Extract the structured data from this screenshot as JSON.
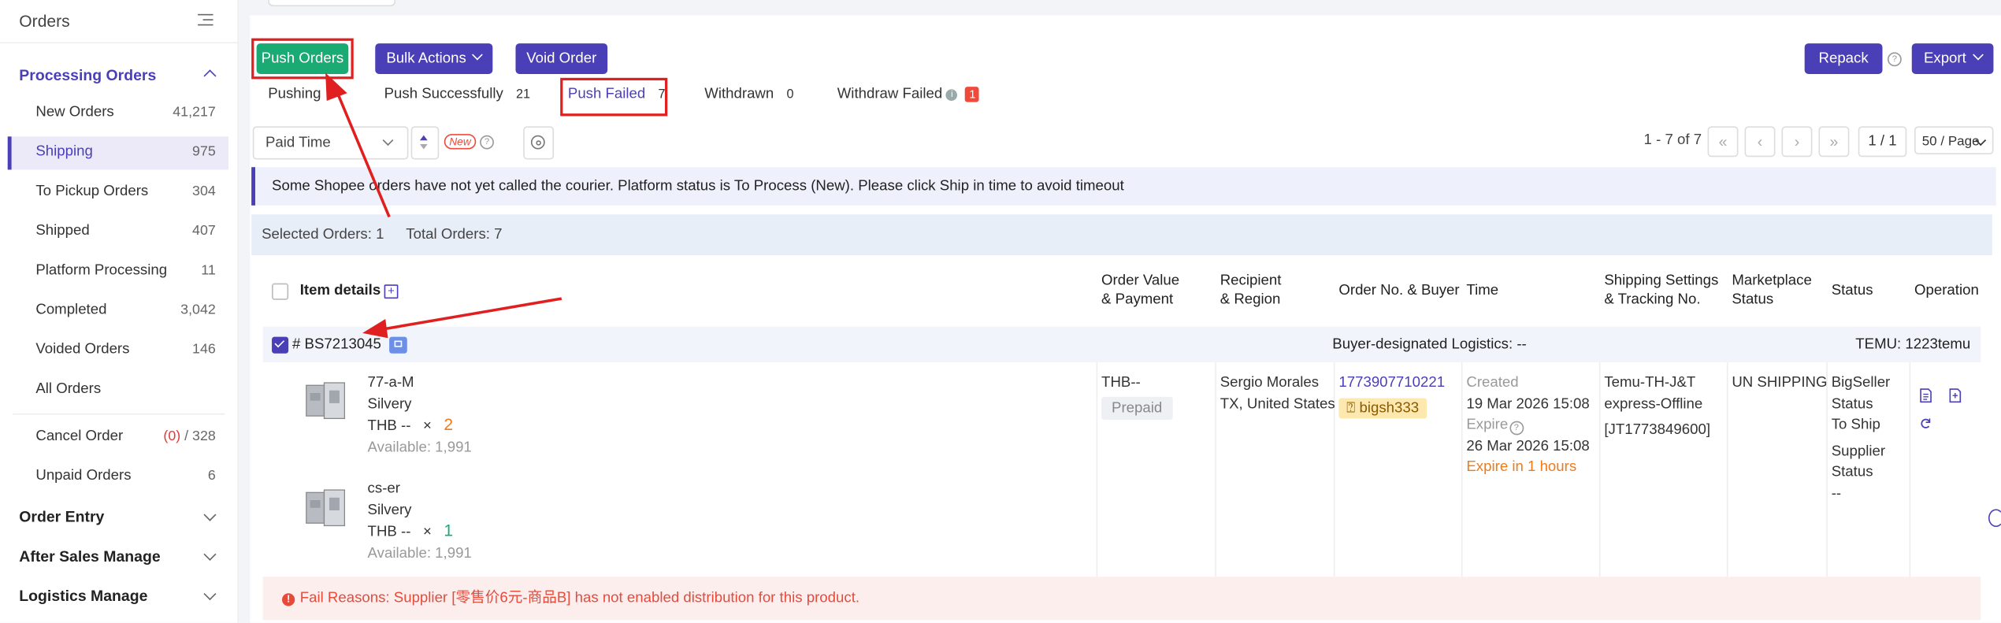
{
  "sidebar": {
    "title": "Orders",
    "processing_label": "Processing Orders",
    "items": [
      {
        "label": "New Orders",
        "count": "41,217"
      },
      {
        "label": "Shipping",
        "count": "975"
      },
      {
        "label": "To Pickup Orders",
        "count": "304"
      },
      {
        "label": "Shipped",
        "count": "407"
      },
      {
        "label": "Platform Processing",
        "count": "11"
      },
      {
        "label": "Completed",
        "count": "3,042"
      },
      {
        "label": "Voided Orders",
        "count": "146"
      },
      {
        "label": "All Orders",
        "count": ""
      }
    ],
    "cancel": {
      "label": "Cancel Order",
      "count_red": "(0)",
      "count_rest": "/ 328"
    },
    "unpaid": {
      "label": "Unpaid Orders",
      "count": "6"
    },
    "groups": {
      "order_entry": "Order Entry",
      "after_sales": "After Sales Manage",
      "logistics": "Logistics Manage"
    }
  },
  "toolbar": {
    "push_orders": "Push Orders",
    "bulk_actions": "Bulk Actions",
    "void_order": "Void Order",
    "repack": "Repack",
    "export": "Export"
  },
  "tabs": [
    {
      "label": "Pushing",
      "count": ""
    },
    {
      "label": "Push Successfully",
      "count": "21"
    },
    {
      "label": "Push Failed",
      "count": "7"
    },
    {
      "label": "Withdrawn",
      "count": "0"
    },
    {
      "label": "Withdraw Failed",
      "count": "1"
    }
  ],
  "filter": {
    "sort_field": "Paid Time",
    "new_tag": "New"
  },
  "pager": {
    "range": "1 - 7 of 7",
    "page": "1 / 1",
    "page_size": "50 / Page"
  },
  "notice": "Some Shopee orders have not yet called the courier. Platform status is To Process (New). Please click Ship in time to avoid timeout",
  "summary": {
    "selected": "Selected Orders: 1",
    "total": "Total Orders: 7"
  },
  "columns": {
    "item": "Item details",
    "value_1": "Order Value",
    "value_2": "& Payment",
    "recip_1": "Recipient",
    "recip_2": "& Region",
    "orderno": "Order No. & Buyer",
    "time": "Time",
    "ship_1": "Shipping Settings",
    "ship_2": "& Tracking No.",
    "mkt_1": "Marketplace",
    "mkt_2": "Status",
    "status": "Status",
    "operation": "Operation"
  },
  "order": {
    "id": "# BS7213045",
    "logistics": "Buyer-designated Logistics: --",
    "store": "TEMU: 1223temu",
    "items": [
      {
        "sku": "77-a-M",
        "variant": "Silvery",
        "price": "THB --",
        "x": "×",
        "qty": "2",
        "available": "Available: 1,991"
      },
      {
        "sku": "cs-er",
        "variant": "Silvery",
        "price": "THB --",
        "x": "×",
        "qty": "1",
        "available": "Available: 1,991"
      }
    ],
    "value": "THB--",
    "payment": "Prepaid",
    "recipient": "Sergio Morales",
    "region": "TX, United States",
    "order_no": "1773907710221",
    "buyer": "bigsh333",
    "created_label": "Created",
    "created": "19 Mar 2026 15:08",
    "expire_label": "Expire",
    "expire": "26 Mar 2026 15:08",
    "expire_in": "Expire in 1 hours",
    "shipping_1": "Temu-TH-J&T",
    "shipping_2": "express-Offline",
    "tracking": "[JT1773849600]",
    "marketplace_status": "UN SHIPPING",
    "status_lines": [
      "BigSeller",
      "Status",
      "To Ship",
      "Supplier",
      "Status",
      "--"
    ],
    "fail_reason": "Fail Reasons: Supplier [零售价6元-商品B] has not enabled distribution for this product."
  },
  "colors": {
    "accent": "#4b3fb8",
    "green": "#1aaa74",
    "red": "#e02020",
    "orange": "#f07a18"
  }
}
